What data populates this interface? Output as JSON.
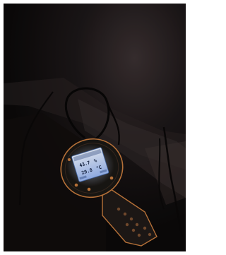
{
  "photo": {
    "subject": "handheld-hygrometer",
    "colors": {
      "background": "#ffffff",
      "room_dark": "#0c0a0b",
      "wall": "#2b2424",
      "device_body": "#1a1714",
      "device_accent": "#c57a3d",
      "screen_glow": "#b9d6ff",
      "cable": "#0a0a0a"
    },
    "display": {
      "humidity_value": "43.7",
      "humidity_unit": "%",
      "temperature_value": "29.8",
      "temperature_unit": "°C"
    }
  }
}
